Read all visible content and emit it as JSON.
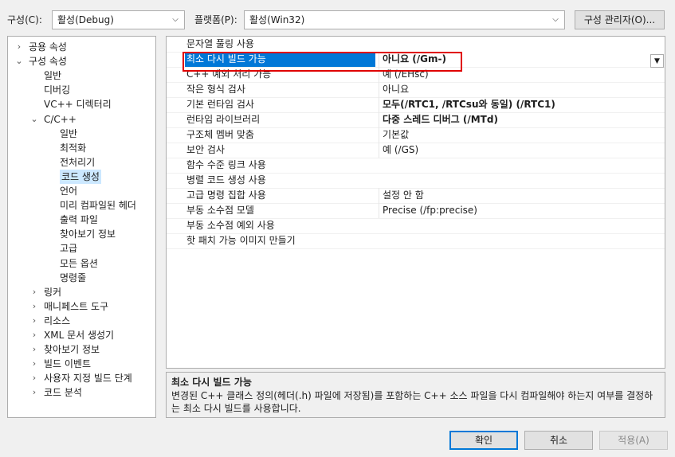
{
  "toolbar": {
    "config_label": "구성(C):",
    "config_value": "활성(Debug)",
    "platform_label": "플랫폼(P):",
    "platform_value": "활성(Win32)",
    "config_manager": "구성 관리자(O)..."
  },
  "tree": [
    {
      "label": "공용 속성",
      "chev": "›"
    },
    {
      "label": "구성 속성",
      "chev": "⌄"
    },
    {
      "label": "일반",
      "chev": ""
    },
    {
      "label": "디버깅",
      "chev": ""
    },
    {
      "label": "VC++ 디렉터리",
      "chev": ""
    },
    {
      "label": "C/C++",
      "chev": "⌄"
    },
    {
      "label": "일반",
      "chev": ""
    },
    {
      "label": "최적화",
      "chev": ""
    },
    {
      "label": "전처리기",
      "chev": ""
    },
    {
      "label": "코드 생성",
      "chev": "",
      "selected": true
    },
    {
      "label": "언어",
      "chev": ""
    },
    {
      "label": "미리 컴파일된 헤더",
      "chev": ""
    },
    {
      "label": "출력 파일",
      "chev": ""
    },
    {
      "label": "찾아보기 정보",
      "chev": ""
    },
    {
      "label": "고급",
      "chev": ""
    },
    {
      "label": "모든 옵션",
      "chev": ""
    },
    {
      "label": "명령줄",
      "chev": ""
    },
    {
      "label": "링커",
      "chev": "›"
    },
    {
      "label": "매니페스트 도구",
      "chev": "›"
    },
    {
      "label": "리소스",
      "chev": "›"
    },
    {
      "label": "XML 문서 생성기",
      "chev": "›"
    },
    {
      "label": "찾아보기 정보",
      "chev": "›"
    },
    {
      "label": "빌드 이벤트",
      "chev": "›"
    },
    {
      "label": "사용자 지정 빌드 단계",
      "chev": "›"
    },
    {
      "label": "코드 분석",
      "chev": "›"
    }
  ],
  "properties": [
    {
      "name": "문자열 풀링 사용",
      "value": ""
    },
    {
      "name": "최소 다시 빌드 가능",
      "value": "아니요 (/Gm-)"
    },
    {
      "name": "C++ 예외 처리 가능",
      "value": "예 (/EHsc)"
    },
    {
      "name": "작은 형식 검사",
      "value": "아니요"
    },
    {
      "name": "기본 런타임 검사",
      "value": "모두(/RTC1, /RTCsu와 동일) (/RTC1)"
    },
    {
      "name": "런타임 라이브러리",
      "value": "다중 스레드 디버그 (/MTd)"
    },
    {
      "name": "구조체 멤버 맞춤",
      "value": "기본값"
    },
    {
      "name": "보안 검사",
      "value": "예 (/GS)"
    },
    {
      "name": "함수 수준 링크 사용",
      "value": ""
    },
    {
      "name": "병렬 코드 생성 사용",
      "value": ""
    },
    {
      "name": "고급 명령 집합 사용",
      "value": "설정 안 함"
    },
    {
      "name": "부동 소수점 모델",
      "value": "Precise (/fp:precise)"
    },
    {
      "name": "부동 소수점 예외 사용",
      "value": ""
    },
    {
      "name": "핫 패치 가능 이미지 만들기",
      "value": ""
    }
  ],
  "description": {
    "title": "최소 다시 빌드 가능",
    "body": "변경된 C++ 클래스 정의(헤더(.h) 파일에 저장됨)를 포함하는 C++ 소스 파일을 다시 컴파일해야 하는지 여부를 결정하는 최소 다시 빌드를 사용합니다."
  },
  "buttons": {
    "ok": "확인",
    "cancel": "취소",
    "apply": "적용(A)"
  },
  "icons": {
    "dropdown": "chevron-down-icon",
    "tree_expand": "chevron-right-icon",
    "tree_collapse": "chevron-down-icon"
  }
}
